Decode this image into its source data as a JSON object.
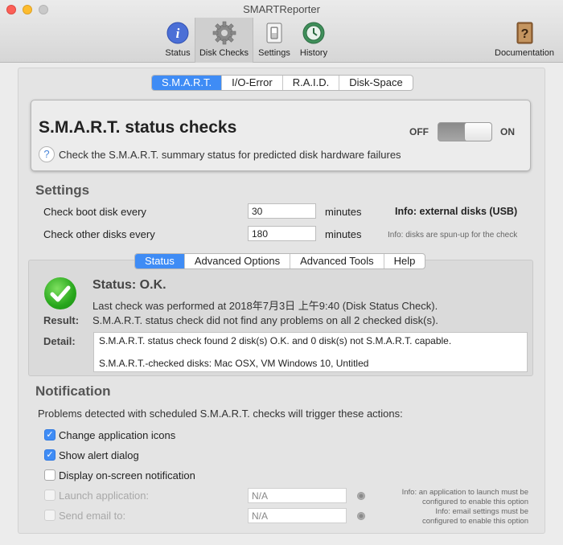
{
  "window": {
    "title": "SMARTReporter"
  },
  "toolbar": {
    "items": [
      {
        "label": "Status",
        "icon": "info-icon"
      },
      {
        "label": "Disk Checks",
        "icon": "gear-icon",
        "selected": true
      },
      {
        "label": "Settings",
        "icon": "switch-icon"
      },
      {
        "label": "History",
        "icon": "time-machine-icon"
      },
      {
        "label": "Documentation",
        "icon": "help-book-icon"
      }
    ]
  },
  "check_tabs": [
    "S.M.A.R.T.",
    "I/O-Error",
    "R.A.I.D.",
    "Disk-Space"
  ],
  "smart": {
    "title": "S.M.A.R.T. status checks",
    "description": "Check the S.M.A.R.T. summary status for predicted disk hardware failures",
    "help_symbol": "?",
    "toggle_off": "OFF",
    "toggle_on": "ON"
  },
  "settings": {
    "heading": "Settings",
    "boot_label": "Check boot disk every",
    "boot_value": "30",
    "other_label": "Check other disks every",
    "other_value": "180",
    "unit": "minutes",
    "info_bold": "Info: external disks (USB)",
    "info_small": "Info: disks are spun-up for the check"
  },
  "status_tabs": [
    "Status",
    "Advanced Options",
    "Advanced Tools",
    "Help"
  ],
  "status": {
    "title": "Status: O.K.",
    "last_check": "Last check was performed at 2018年7月3日 上午9:40 (Disk Status Check).",
    "result_label": "Result:",
    "result_text": "S.M.A.R.T. status check did not find any problems on all 2 checked disk(s).",
    "detail_label": "Detail:",
    "detail_lines": [
      "S.M.A.R.T. status check found 2 disk(s) O.K. and 0 disk(s) not S.M.A.R.T. capable.",
      "S.M.A.R.T.-checked disks: Mac OSX, VM Windows 10, Untitled"
    ]
  },
  "notification": {
    "heading": "Notification",
    "description": "Problems detected with scheduled S.M.A.R.T. checks will trigger these actions:",
    "options": [
      {
        "label": "Change application icons",
        "checked": true
      },
      {
        "label": "Show alert dialog",
        "checked": true
      },
      {
        "label": "Display on-screen notification",
        "checked": false
      }
    ],
    "launch_label": "Launch application:",
    "launch_value": "N/A",
    "launch_info_1": "Info: an application to launch must be",
    "launch_info_2": "configured to enable this option",
    "email_label": "Send email to:",
    "email_value": "N/A",
    "email_info_1": "Info: email settings must be",
    "email_info_2": "configured to enable this option"
  },
  "colors": {
    "accent": "#3f8cf5",
    "ok_green": "#28a71c"
  }
}
